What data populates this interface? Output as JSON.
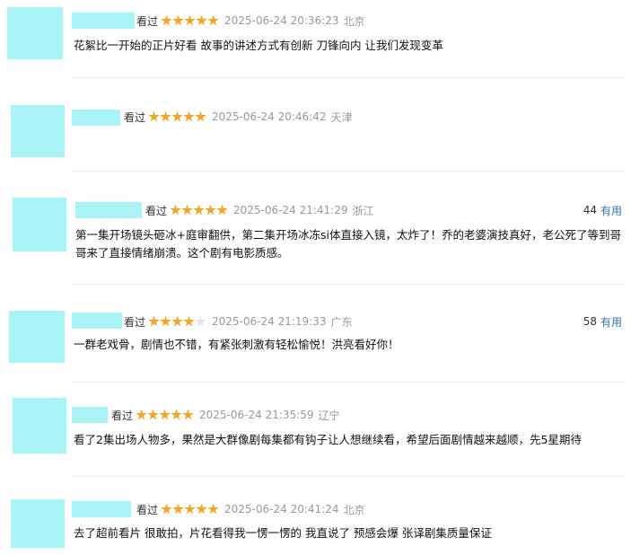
{
  "colors": {
    "placeholder": "#a8f4f6",
    "star": "#f5a623",
    "meta_text": "#999999",
    "useful_link": "#3377aa"
  },
  "reviews": [
    {
      "watched": "看过",
      "stars": 5,
      "time": "2025-06-24 20:36:23",
      "location": "北京",
      "useful_count": "",
      "useful_label": "",
      "content": "花絮比一开始的正片好看 故事的讲述方式有创新 刀锋向内 让我们发现变革"
    },
    {
      "watched": "看过",
      "stars": 5,
      "time": "2025-06-24 20:46:42",
      "location": "天津",
      "useful_count": "",
      "useful_label": "",
      "content": ""
    },
    {
      "watched": "看过",
      "stars": 5,
      "time": "2025-06-24 21:41:29",
      "location": "浙江",
      "useful_count": "44",
      "useful_label": "有用",
      "content": "第一集开场镜头砸冰+庭审翻供，第二集开场冰冻si体直接入镜，太炸了！乔的老婆演技真好，老公死了等到哥哥来了直接情绪崩溃。这个剧有电影质感。"
    },
    {
      "watched": "看过",
      "stars": 4,
      "time": "2025-06-24 21:19:33",
      "location": "广东",
      "useful_count": "58",
      "useful_label": "有用",
      "content": "一群老戏骨，剧情也不错，有紧张刺激有轻松愉悦！洪亮看好你！"
    },
    {
      "watched": "看过",
      "stars": 5,
      "time": "2025-06-24 21:35:59",
      "location": "辽宁",
      "useful_count": "",
      "useful_label": "",
      "content": "看了2集出场人物多，果然是大群像剧每集都有钩子让人想继续看，希望后面剧情越来越顺，先5星期待"
    },
    {
      "watched": "看过",
      "stars": 5,
      "time": "2025-06-24 20:41:24",
      "location": "北京",
      "useful_count": "",
      "useful_label": "",
      "content": "去了超前看片 很敢拍，片花看得我一愣一愣的 我直说了 预感会爆 张译剧集质量保证"
    }
  ]
}
